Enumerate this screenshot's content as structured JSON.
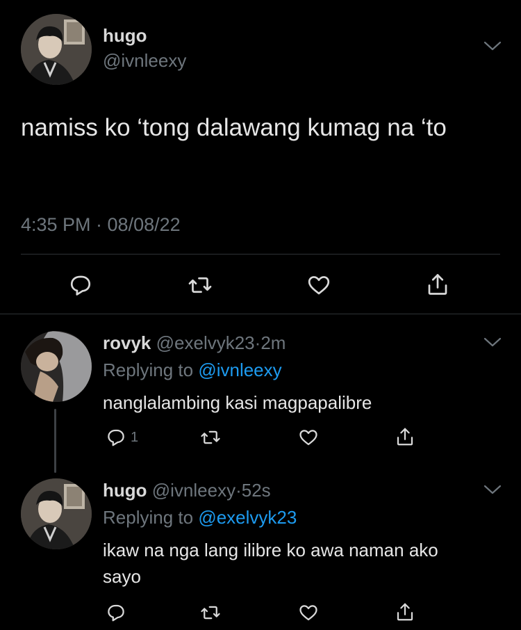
{
  "main_tweet": {
    "display_name": "hugo",
    "handle": "@ivnleexy",
    "text": "namiss ko ‘tong dalawang kumag na ‘to",
    "timestamp": "4:35 PM · 08/08/22"
  },
  "replies": [
    {
      "display_name": "rovyk",
      "handle": "@exelvyk23",
      "sep": "·",
      "time": "2m",
      "replying_prefix": "Replying to",
      "replying_to": "@ivnleexy",
      "text": "nanglalambing kasi magpapalibre",
      "reply_count": "1"
    },
    {
      "display_name": "hugo",
      "handle": "@ivnleexy",
      "sep": "·",
      "time": "52s",
      "replying_prefix": "Replying to",
      "replying_to": "@exelvyk23",
      "text": "ikaw na nga lang ilibre ko awa naman ako sayo",
      "reply_count": ""
    }
  ],
  "colors": {
    "background": "#000000",
    "text": "#d9d9d9",
    "secondary": "#6e767d",
    "mention": "#1d9bf0",
    "divider": "#2f3336"
  },
  "icons": [
    "chevron-down-icon",
    "reply-icon",
    "retweet-icon",
    "like-icon",
    "share-icon"
  ]
}
